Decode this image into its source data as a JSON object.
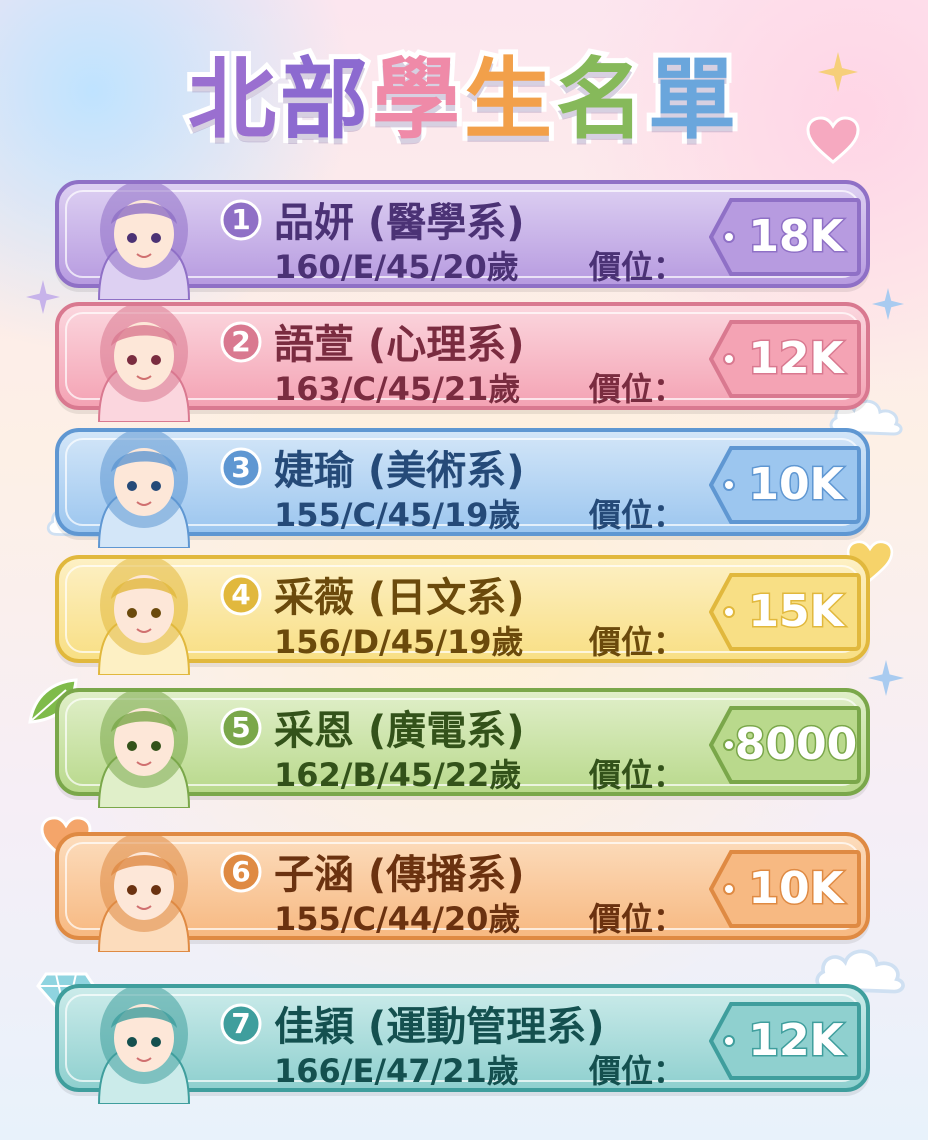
{
  "title": {
    "chars": [
      "北",
      "部",
      "學",
      "生",
      "名",
      "單"
    ]
  },
  "price_label": "價位：",
  "students": [
    {
      "rank": "1",
      "name": "品妍 (醫學系)",
      "stats": "160/E/45/20歲",
      "price": "18K",
      "color": "#b79be0",
      "border": "#8f70c6",
      "light": "#ddd0f2",
      "text": "#4b3275"
    },
    {
      "rank": "2",
      "name": "語萱 (心理系)",
      "stats": "163/C/45/21歲",
      "price": "12K",
      "color": "#f4a3b4",
      "border": "#d97990",
      "light": "#fbd6de",
      "text": "#7a2c40"
    },
    {
      "rank": "3",
      "name": "婕瑜 (美術系)",
      "stats": "155/C/45/19歲",
      "price": "10K",
      "color": "#9cc6ef",
      "border": "#5f97d2",
      "light": "#d3e6f8",
      "text": "#254a78"
    },
    {
      "rank": "4",
      "name": "采薇 (日文系)",
      "stats": "156/D/45/19歲",
      "price": "15K",
      "color": "#f8df85",
      "border": "#e1b83d",
      "light": "#fdf0c4",
      "text": "#6b4a0c"
    },
    {
      "rank": "5",
      "name": "采恩 (廣電系)",
      "stats": "162/B/45/22歲",
      "price": "8000",
      "color": "#b9d98c",
      "border": "#7aa74a",
      "light": "#e0efc9",
      "text": "#33521a"
    },
    {
      "rank": "6",
      "name": "子涵 (傳播系)",
      "stats": "155/C/44/20歲",
      "price": "10K",
      "color": "#f7b982",
      "border": "#df8a43",
      "light": "#fcdcbc",
      "text": "#6b3210"
    },
    {
      "rank": "7",
      "name": "佳穎 (運動管理系)",
      "stats": "166/E/47/21歲",
      "price": "12K",
      "color": "#8fd0cf",
      "border": "#3f9e9d",
      "light": "#cbebea",
      "text": "#14504f"
    }
  ]
}
